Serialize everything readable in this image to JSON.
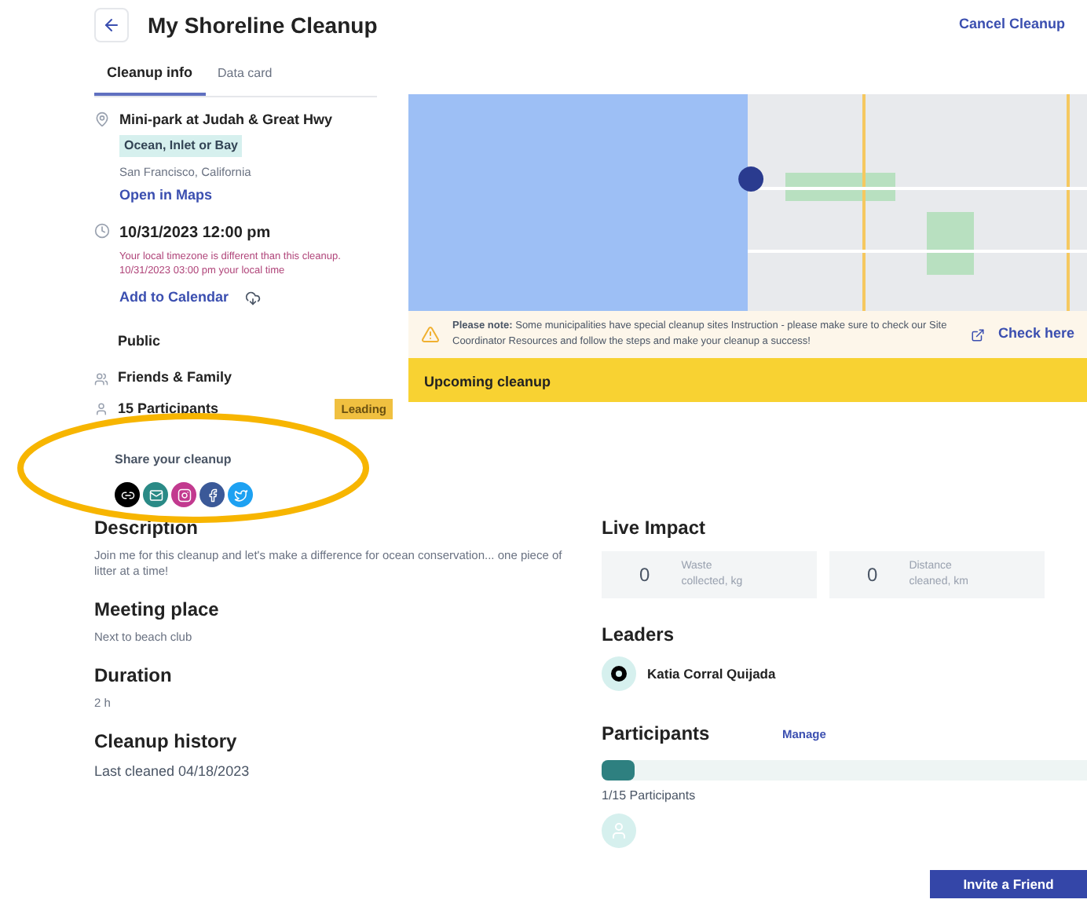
{
  "header": {
    "title": "My Shoreline Cleanup",
    "cancel": "Cancel Cleanup"
  },
  "tabs": [
    {
      "label": "Cleanup info",
      "selected": true
    },
    {
      "label": "Data card",
      "selected": false
    }
  ],
  "location": {
    "name": "Mini-park at Judah & Great Hwy",
    "tag": "Ocean, Inlet or Bay",
    "city": "San Francisco, California",
    "link": "Open in Maps"
  },
  "date": {
    "datetime": "10/31/2023 12:00 pm",
    "notice": "Your local timezone is different than this cleanup.",
    "local_time": "10/31/2023 03:00 pm your local time",
    "link": "Add to Calendar"
  },
  "visibility": "Public",
  "audience": "Friends & Family",
  "participants_count": {
    "label": "15 Participants",
    "badge": "Leading"
  },
  "share": {
    "title": "Share your cleanup",
    "icons": [
      {
        "kind": "link",
        "color": "#000000"
      },
      {
        "kind": "email",
        "color": "#2a8a86"
      },
      {
        "kind": "instagram",
        "color": "#c23a8f"
      },
      {
        "kind": "facebook",
        "color": "#3b5998"
      },
      {
        "kind": "twitter",
        "color": "#1da1f2"
      }
    ]
  },
  "notice": {
    "text": "**Please note:** Some municipalities have special cleanup sites Instruction - please make sure to check our Site Coordinator Resources and follow the steps and make your cleanup a success!",
    "link": "Check here"
  },
  "status": "Upcoming cleanup",
  "sections": [
    {
      "title": "Description",
      "text": "Join me for this cleanup and let's make a difference for ocean conservation... one piece of litter at a time!"
    },
    {
      "title": "Meeting place",
      "text": "Next to beach club"
    },
    {
      "title": "Duration",
      "text": "2 h"
    },
    {
      "title": "Cleanup history",
      "text": "Last cleaned 04/18/2023"
    }
  ],
  "live_impact": {
    "title": "Live Impact",
    "stats": [
      {
        "value": "0",
        "label": "Waste collected, kg"
      },
      {
        "value": "0",
        "label": "Distance cleaned, km"
      }
    ]
  },
  "leaders": {
    "title": "Leaders",
    "names": [
      "Katia Corral Quijada"
    ]
  },
  "participants": {
    "title": "Participants",
    "manage": "Manage",
    "level": 0.067,
    "count": "1/15 Participants"
  },
  "invite": "Invite a Friend"
}
